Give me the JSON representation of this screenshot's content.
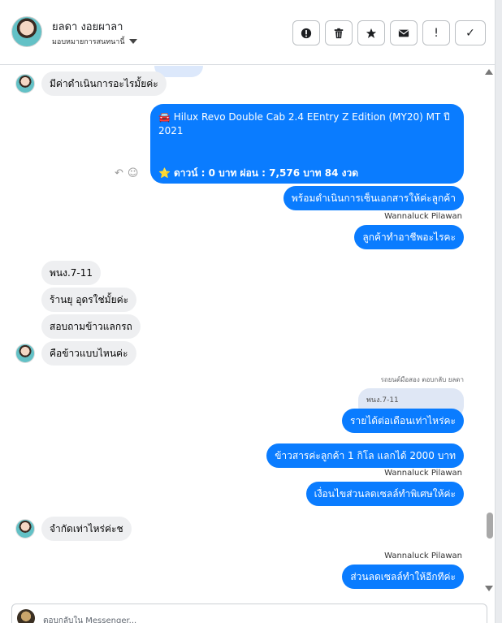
{
  "header": {
    "name": "ยลดา งอยผาลา",
    "assign_label": "มอบหมายการสนทนานี้"
  },
  "toolbar": {
    "buttons": [
      {
        "icon": "alert-circle-icon"
      },
      {
        "icon": "trash-icon"
      },
      {
        "icon": "star-icon"
      },
      {
        "icon": "envelope-icon"
      },
      {
        "icon": "exclamation-icon",
        "glyph": "!"
      },
      {
        "icon": "check-icon",
        "glyph": "✓"
      }
    ]
  },
  "messages": {
    "m1": "มีค่าดำเนินการอะไรมั้ยค่ะ",
    "card_title": "🚘 Hilux Revo Double Cab 2.4 EEntry Z Edition (MY20) MT ปี 2021",
    "card_promo": "ดาวน์ : 0 บาท ผ่อน : 7,576 บาท 84 งวด",
    "m2": "พร้อมดำเนินการเซ็นเอกสารให้ค่ะลูกค้า",
    "sender1": "Wannaluck Pilawan",
    "m3": "ลูกค้าทำอาชีพอะไรคะ",
    "m4": "พนง.7-11",
    "m5": "ร้านยุ อุดรใช่มั้ยค่ะ",
    "m6": "สอบถามข้าวแลกรถ",
    "m7": "คือข้าวแบบไหนค่ะ",
    "reply_context": "รถยนต์มือสอง ตอบกลับ ยลดา",
    "quote": "พนง.7-11",
    "m8": "รายได้ต่อเดือนเท่าไหร่คะ",
    "m9": "ข้าวสารค่ะลูกค้า  1 กิโล แลกได้  2000 บาท",
    "sender2": "Wannaluck Pilawan",
    "m10": "เงื่อนไขส่วนลดเซลล์ทำพิเศษให้ค่ะ",
    "m11": "จำกัดเท่าไหร่ค่ะช",
    "sender3": "Wannaluck Pilawan",
    "m12": "ส่วนลดเซลล์ทำให้อีกทีค่ะ"
  },
  "composer": {
    "placeholder": "ตอบกลับใน Messenger..."
  },
  "colors": {
    "outgoing": "#0a7cff",
    "incoming": "#eeeff1"
  }
}
